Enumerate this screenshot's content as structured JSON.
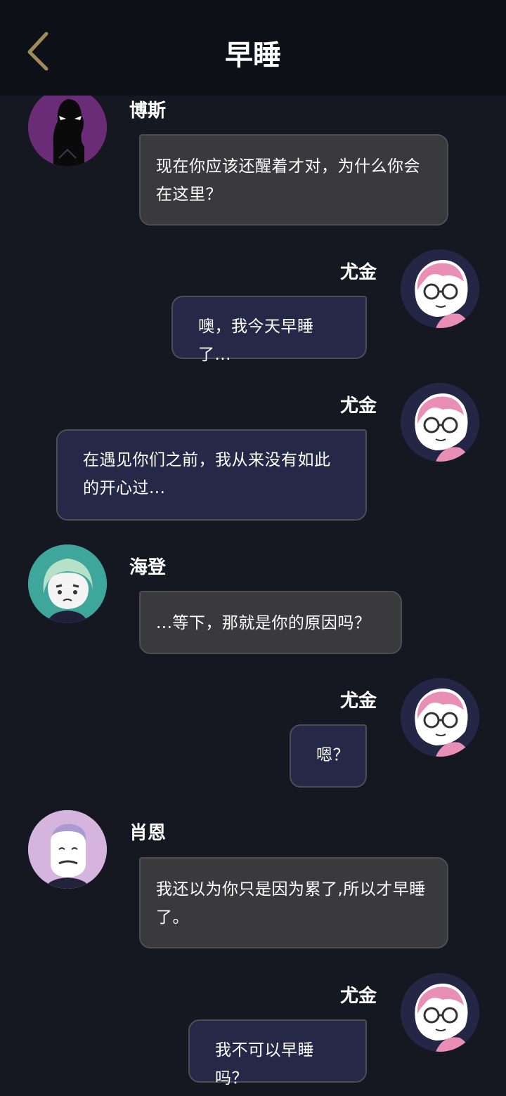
{
  "header": {
    "title": "早睡",
    "back_icon": "chevron-left-icon",
    "back_color": "#a08a5a"
  },
  "colors": {
    "background": "#151821",
    "left_bubble": "#3a3a3c",
    "right_bubble": "#252846"
  },
  "messages": [
    {
      "sender": "博斯",
      "side": "left",
      "avatar": "silhouette-avatar",
      "text": "现在你应该还醒着才对，为什么你会在这里？"
    },
    {
      "sender": "尤金",
      "side": "right",
      "avatar": "pink-hair-avatar",
      "text": "噢，我今天早睡了..."
    },
    {
      "sender": "尤金",
      "side": "right",
      "avatar": "pink-hair-avatar",
      "text": "在遇见你们之前，我从来没有如此的开心过..."
    },
    {
      "sender": "海登",
      "side": "left",
      "avatar": "teal-hair-avatar",
      "text": "...等下，那就是你的原因吗？"
    },
    {
      "sender": "尤金",
      "side": "right",
      "avatar": "pink-hair-avatar",
      "text": "嗯？"
    },
    {
      "sender": "肖恩",
      "side": "left",
      "avatar": "purple-man-avatar",
      "text": "我还以为你只是因为累了,所以才早睡了。"
    },
    {
      "sender": "尤金",
      "side": "right",
      "avatar": "pink-hair-avatar",
      "text": "我不可以早睡吗？"
    }
  ]
}
